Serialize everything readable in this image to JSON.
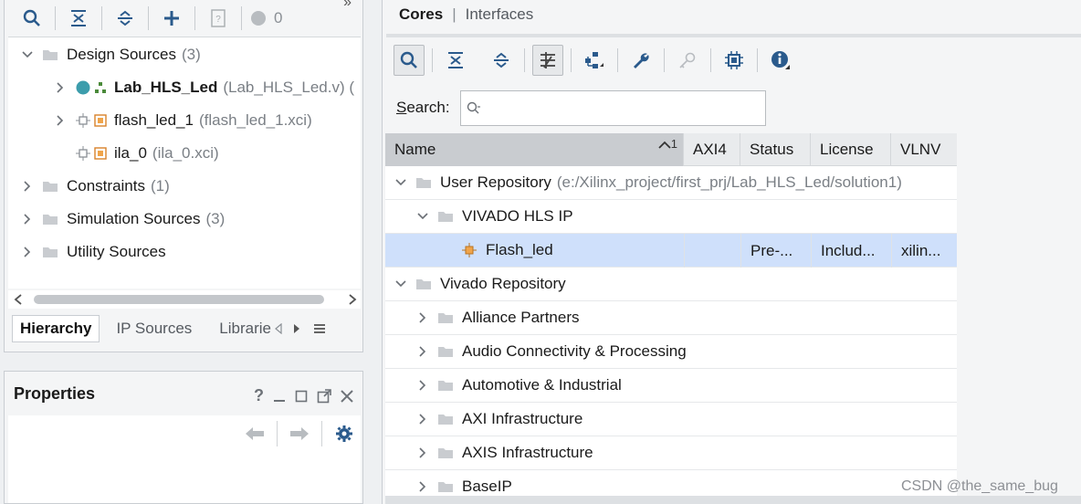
{
  "sources": {
    "toolbar": {
      "badge_count": "0",
      "overflow": "»"
    },
    "tree": [
      {
        "label": "Design Sources",
        "count": "(3)",
        "expanded": true
      },
      {
        "label": "Lab_HLS_Led",
        "detail": "(Lab_HLS_Led.v) (",
        "expanded": false
      },
      {
        "label": "flash_led_1",
        "detail": "(flash_led_1.xci)",
        "expanded": false
      },
      {
        "label": "ila_0",
        "detail": "(ila_0.xci)"
      },
      {
        "label": "Constraints",
        "count": "(1)",
        "expanded": false
      },
      {
        "label": "Simulation Sources",
        "count": "(3)",
        "expanded": false
      },
      {
        "label": "Utility Sources",
        "expanded": false
      }
    ],
    "tabs": {
      "hierarchy": "Hierarchy",
      "ip_sources": "IP Sources",
      "libraries": "Librarie"
    }
  },
  "properties": {
    "title": "Properties",
    "help": "?"
  },
  "catalog": {
    "tabs": {
      "cores": "Cores",
      "separator": "|",
      "interfaces": "Interfaces"
    },
    "search": {
      "label_accel": "S",
      "label_rest": "earch:",
      "placeholder": "",
      "value": ""
    },
    "columns": {
      "name": "Name",
      "sort": "1",
      "axi4": "AXI4",
      "status": "Status",
      "license": "License",
      "vlnv": "VLNV"
    },
    "rows": [
      {
        "label": "User Repository",
        "detail": "(e:/Xilinx_project/first_prj/Lab_HLS_Led/solution1)"
      },
      {
        "label": "VIVADO HLS IP"
      },
      {
        "label": "Flash_led",
        "status": "Pre-...",
        "license": "Includ...",
        "vlnv": "xilin..."
      },
      {
        "label": "Vivado Repository"
      },
      {
        "label": "Alliance Partners"
      },
      {
        "label": "Audio Connectivity & Processing"
      },
      {
        "label": "Automotive & Industrial"
      },
      {
        "label": "AXI Infrastructure"
      },
      {
        "label": "AXIS Infrastructure"
      },
      {
        "label": "BaseIP"
      }
    ]
  },
  "watermark": "CSDN @the_same_bug"
}
